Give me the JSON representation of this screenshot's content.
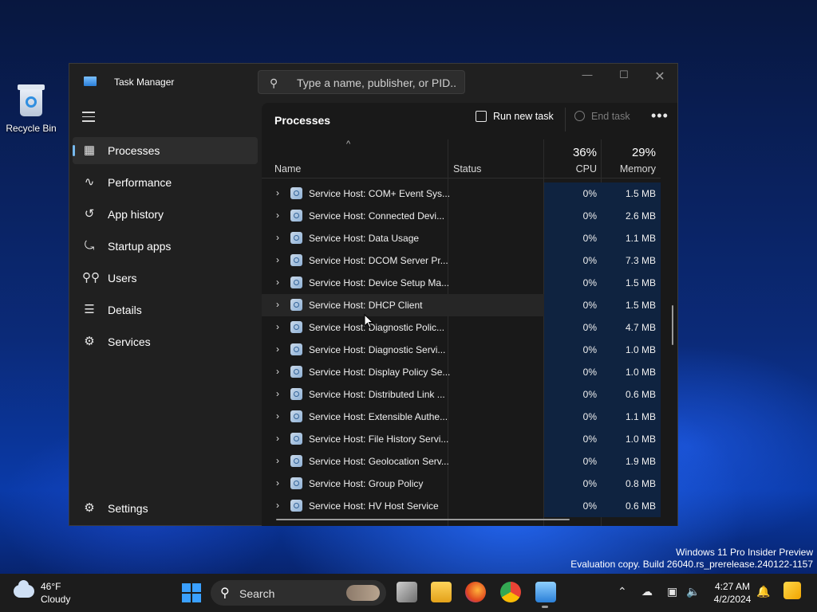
{
  "desktop": {
    "recycle_bin_label": "Recycle Bin"
  },
  "window": {
    "title": "Task Manager",
    "search_placeholder": "Type a name, publisher, or PID...",
    "controls": {
      "minimize": "—",
      "maximize": "☐",
      "close": "✕"
    }
  },
  "sidebar": {
    "items": [
      {
        "label": "Processes",
        "icon": "processes-icon"
      },
      {
        "label": "Performance",
        "icon": "performance-icon"
      },
      {
        "label": "App history",
        "icon": "app-history-icon"
      },
      {
        "label": "Startup apps",
        "icon": "startup-apps-icon"
      },
      {
        "label": "Users",
        "icon": "users-icon"
      },
      {
        "label": "Details",
        "icon": "details-icon"
      },
      {
        "label": "Services",
        "icon": "services-icon"
      }
    ],
    "settings_label": "Settings"
  },
  "toolbar": {
    "page_title": "Processes",
    "run_new_task": "Run new task",
    "end_task": "End task",
    "more": "•••"
  },
  "table": {
    "columns": {
      "name": "Name",
      "status": "Status",
      "cpu": "CPU",
      "memory": "Memory"
    },
    "cpu_total": "36%",
    "memory_total": "29%",
    "sort_indicator": "^",
    "rows": [
      {
        "name": "Service Host: COM+ Event Sys...",
        "status": "",
        "cpu": "0%",
        "memory": "1.5 MB"
      },
      {
        "name": "Service Host: Connected Devi...",
        "status": "",
        "cpu": "0%",
        "memory": "2.6 MB"
      },
      {
        "name": "Service Host: Data Usage",
        "status": "",
        "cpu": "0%",
        "memory": "1.1 MB"
      },
      {
        "name": "Service Host: DCOM Server Pr...",
        "status": "",
        "cpu": "0%",
        "memory": "7.3 MB"
      },
      {
        "name": "Service Host: Device Setup Ma...",
        "status": "",
        "cpu": "0%",
        "memory": "1.5 MB"
      },
      {
        "name": "Service Host: DHCP Client",
        "status": "",
        "cpu": "0%",
        "memory": "1.5 MB"
      },
      {
        "name": "Service Host: Diagnostic Polic...",
        "status": "",
        "cpu": "0%",
        "memory": "4.7 MB"
      },
      {
        "name": "Service Host: Diagnostic Servi...",
        "status": "",
        "cpu": "0%",
        "memory": "1.0 MB"
      },
      {
        "name": "Service Host: Display Policy Se...",
        "status": "",
        "cpu": "0%",
        "memory": "1.0 MB"
      },
      {
        "name": "Service Host: Distributed Link ...",
        "status": "",
        "cpu": "0%",
        "memory": "0.6 MB"
      },
      {
        "name": "Service Host: Extensible Authe...",
        "status": "",
        "cpu": "0%",
        "memory": "1.1 MB"
      },
      {
        "name": "Service Host: File History Servi...",
        "status": "",
        "cpu": "0%",
        "memory": "1.0 MB"
      },
      {
        "name": "Service Host: Geolocation Serv...",
        "status": "",
        "cpu": "0%",
        "memory": "1.9 MB"
      },
      {
        "name": "Service Host: Group Policy",
        "status": "",
        "cpu": "0%",
        "memory": "0.8 MB"
      },
      {
        "name": "Service Host: HV Host Service",
        "status": "",
        "cpu": "0%",
        "memory": "0.6 MB"
      }
    ]
  },
  "watermark": {
    "line1": "Windows 11 Pro Insider Preview",
    "line2": "Evaluation copy. Build 26040.rs_prerelease.240122-1157"
  },
  "taskbar": {
    "weather_temp": "46°F",
    "weather_desc": "Cloudy",
    "search_label": "Search",
    "time": "4:27 AM",
    "date": "4/2/2024",
    "apps": [
      "task-view",
      "file-explorer",
      "firefox",
      "chrome",
      "task-manager"
    ]
  },
  "colors": {
    "accent": "#76b9ed",
    "window_bg": "#202020",
    "panel_bg": "#191919",
    "heat_cell": "#0f2340"
  }
}
